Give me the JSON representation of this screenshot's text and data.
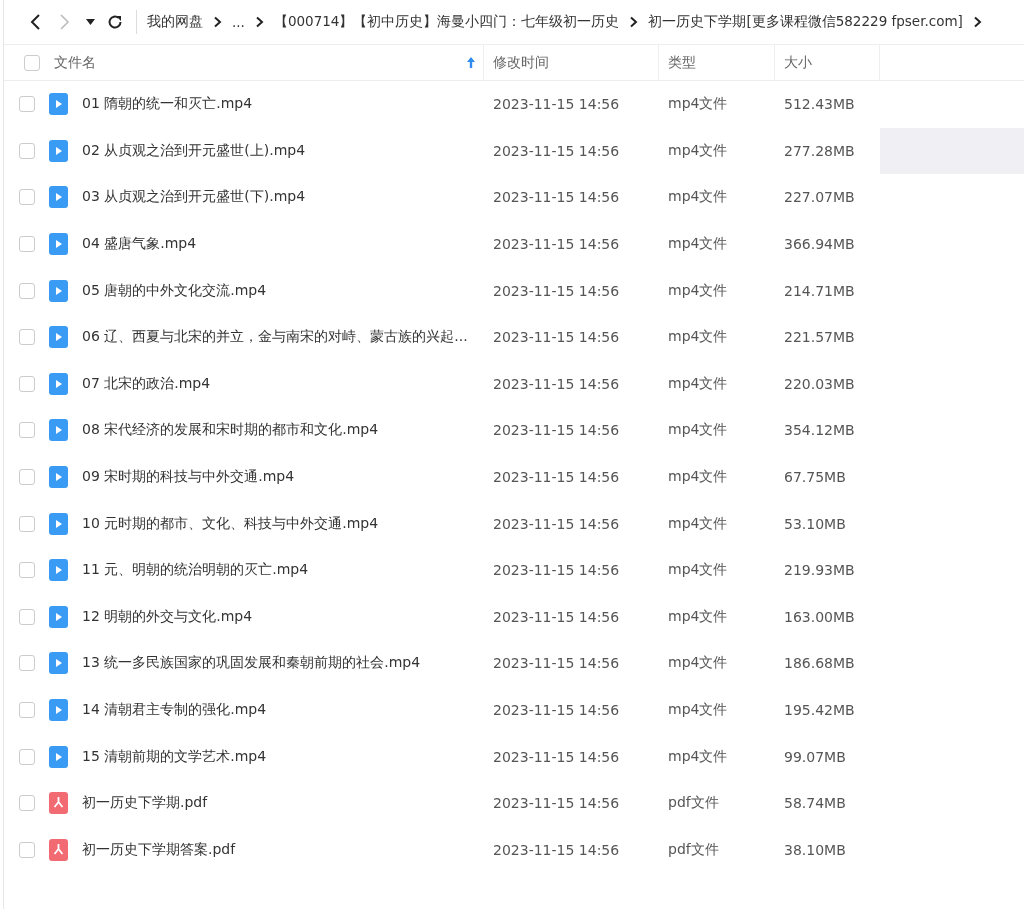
{
  "toolbar": {
    "breadcrumbs": [
      "我的网盘",
      "...",
      "【000714】【初中历史】海曼小四门：七年级初一历史",
      "初一历史下学期[更多课程微信582229 fpser.com]"
    ]
  },
  "table": {
    "all_checked": false,
    "columns": [
      "文件名",
      "修改时间",
      "类型",
      "大小"
    ],
    "rows": [
      {
        "kind": "video",
        "name": "01 隋朝的统一和灭亡.mp4",
        "modified": "2023-11-15 14:56",
        "type": "mp4文件",
        "size": "512.43MB",
        "checked": false,
        "highlighted": false
      },
      {
        "kind": "video",
        "name": "02 从贞观之治到开元盛世(上).mp4",
        "modified": "2023-11-15 14:56",
        "type": "mp4文件",
        "size": "277.28MB",
        "checked": false,
        "highlighted": true
      },
      {
        "kind": "video",
        "name": "03 从贞观之治到开元盛世(下).mp4",
        "modified": "2023-11-15 14:56",
        "type": "mp4文件",
        "size": "227.07MB",
        "checked": false,
        "highlighted": false
      },
      {
        "kind": "video",
        "name": "04 盛唐气象.mp4",
        "modified": "2023-11-15 14:56",
        "type": "mp4文件",
        "size": "366.94MB",
        "checked": false,
        "highlighted": false
      },
      {
        "kind": "video",
        "name": "05 唐朝的中外文化交流.mp4",
        "modified": "2023-11-15 14:56",
        "type": "mp4文件",
        "size": "214.71MB",
        "checked": false,
        "highlighted": false
      },
      {
        "kind": "video",
        "name": "06 辽、西夏与北宋的并立，金与南宋的对峙、蒙古族的兴起...",
        "modified": "2023-11-15 14:56",
        "type": "mp4文件",
        "size": "221.57MB",
        "checked": false,
        "highlighted": false
      },
      {
        "kind": "video",
        "name": "07 北宋的政治.mp4",
        "modified": "2023-11-15 14:56",
        "type": "mp4文件",
        "size": "220.03MB",
        "checked": false,
        "highlighted": false
      },
      {
        "kind": "video",
        "name": "08 宋代经济的发展和宋时期的都市和文化.mp4",
        "modified": "2023-11-15 14:56",
        "type": "mp4文件",
        "size": "354.12MB",
        "checked": false,
        "highlighted": false
      },
      {
        "kind": "video",
        "name": "09 宋时期的科技与中外交通.mp4",
        "modified": "2023-11-15 14:56",
        "type": "mp4文件",
        "size": "67.75MB",
        "checked": false,
        "highlighted": false
      },
      {
        "kind": "video",
        "name": "10 元时期的都市、文化、科技与中外交通.mp4",
        "modified": "2023-11-15 14:56",
        "type": "mp4文件",
        "size": "53.10MB",
        "checked": false,
        "highlighted": false
      },
      {
        "kind": "video",
        "name": "11 元、明朝的统治明朝的灭亡.mp4",
        "modified": "2023-11-15 14:56",
        "type": "mp4文件",
        "size": "219.93MB",
        "checked": false,
        "highlighted": false
      },
      {
        "kind": "video",
        "name": "12 明朝的外交与文化.mp4",
        "modified": "2023-11-15 14:56",
        "type": "mp4文件",
        "size": "163.00MB",
        "checked": false,
        "highlighted": false
      },
      {
        "kind": "video",
        "name": "13 统一多民族国家的巩固发展和秦朝前期的社会.mp4",
        "modified": "2023-11-15 14:56",
        "type": "mp4文件",
        "size": "186.68MB",
        "checked": false,
        "highlighted": false
      },
      {
        "kind": "video",
        "name": "14 清朝君主专制的强化.mp4",
        "modified": "2023-11-15 14:56",
        "type": "mp4文件",
        "size": "195.42MB",
        "checked": false,
        "highlighted": false
      },
      {
        "kind": "video",
        "name": "15 清朝前期的文学艺术.mp4",
        "modified": "2023-11-15 14:56",
        "type": "mp4文件",
        "size": "99.07MB",
        "checked": false,
        "highlighted": false
      },
      {
        "kind": "pdf",
        "name": "初一历史下学期.pdf",
        "modified": "2023-11-15 14:56",
        "type": "pdf文件",
        "size": "58.74MB",
        "checked": false,
        "highlighted": false
      },
      {
        "kind": "pdf",
        "name": "初一历史下学期答案.pdf",
        "modified": "2023-11-15 14:56",
        "type": "pdf文件",
        "size": "38.10MB",
        "checked": false,
        "highlighted": false
      }
    ]
  }
}
